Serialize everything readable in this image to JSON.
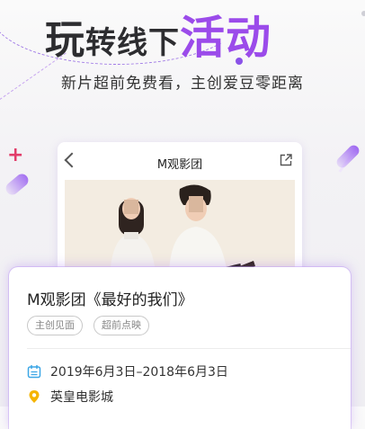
{
  "headline": {
    "parts": [
      "玩",
      "转",
      "线下",
      "活动"
    ]
  },
  "subtitle": "新片超前免费看，主创爱豆零距离",
  "phone": {
    "title": "M观影团"
  },
  "card": {
    "title": "M观影团《最好的我们》",
    "tags": [
      "主创见面",
      "超前点映"
    ],
    "date": "2019年6月3日–2018年6月3日",
    "venue": "英皇电影城"
  },
  "colors": {
    "accent": "#9b4bea",
    "date_icon": "#3da7e6",
    "location_icon": "#f5b400"
  },
  "icons": [
    "chevron-left-icon",
    "share-icon",
    "calendar-icon",
    "location-pin-icon"
  ]
}
